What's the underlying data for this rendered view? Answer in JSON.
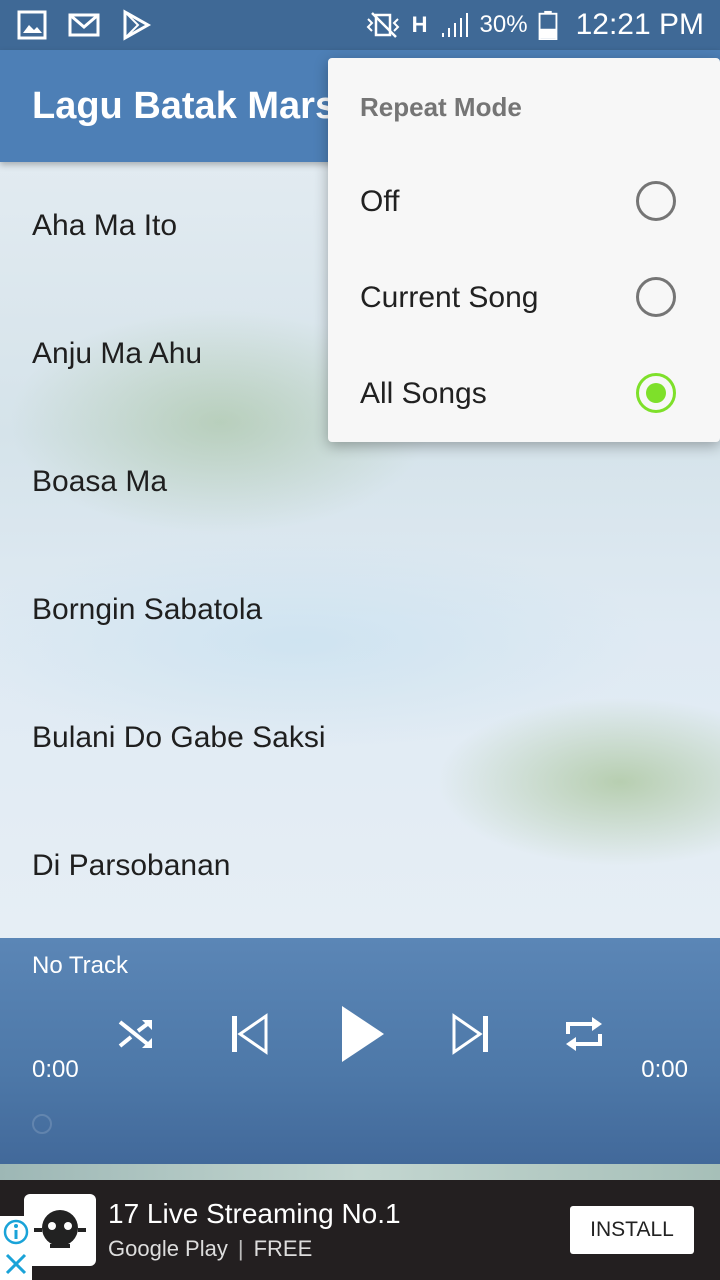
{
  "status_bar": {
    "battery": "30%",
    "time": "12:21 PM",
    "network_type": "H"
  },
  "app_bar": {
    "title": "Lagu Batak Mars"
  },
  "songs": [
    "Aha Ma Ito",
    "Anju Ma Ahu",
    "Boasa Ma",
    "Borngin Sabatola",
    "Bulani Do Gabe Saksi",
    "Di Parsobanan"
  ],
  "player": {
    "track": "No Track",
    "elapsed": "0:00",
    "duration": "0:00"
  },
  "repeat_menu": {
    "title": "Repeat Mode",
    "options": [
      {
        "label": "Off",
        "checked": false
      },
      {
        "label": "Current Song",
        "checked": false
      },
      {
        "label": "All Songs",
        "checked": true
      }
    ]
  },
  "ad": {
    "title": "17 Live Streaming No.1",
    "store": "Google Play",
    "separator": "|",
    "price": "FREE",
    "install_label": "INSTALL"
  },
  "colors": {
    "app_bar": "#4d7fb6",
    "status_bar": "#3f6996",
    "radio_checked": "#7ee02a",
    "player": "#4d78a8",
    "ad_bg": "#231f20"
  }
}
